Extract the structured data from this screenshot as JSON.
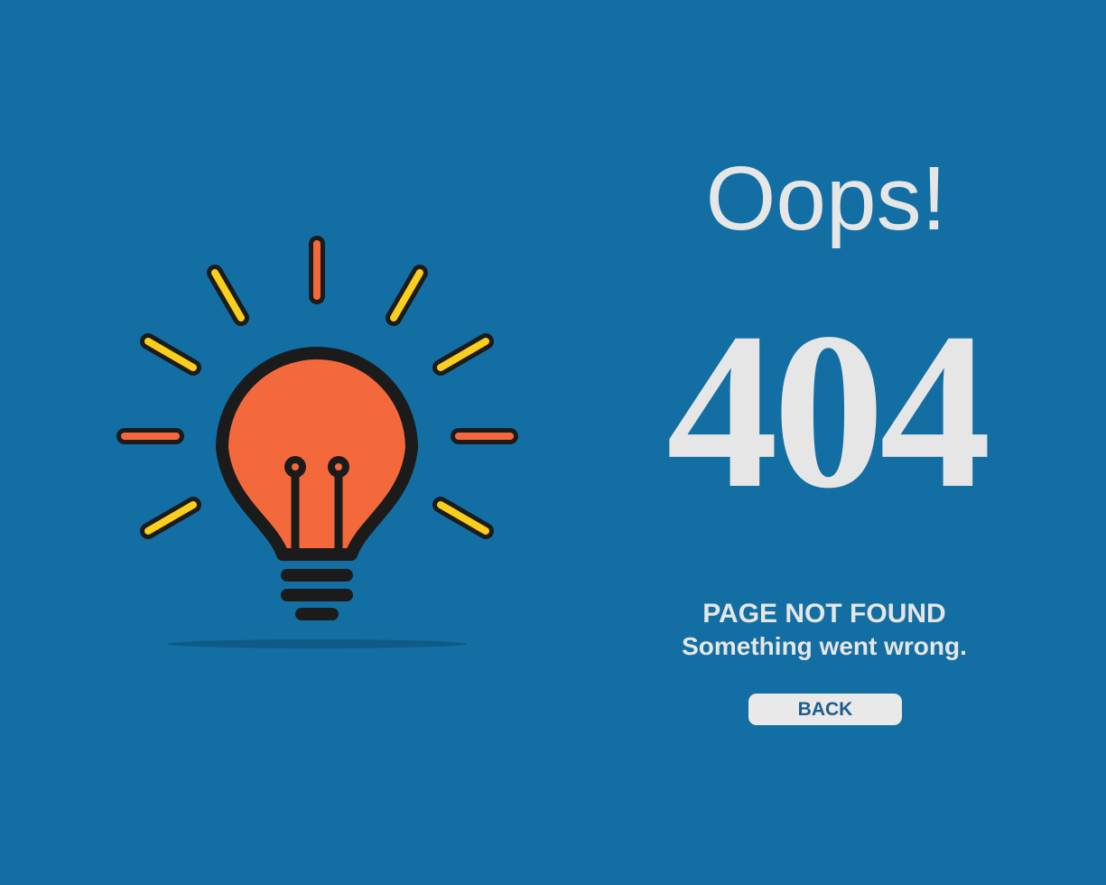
{
  "page": {
    "heading": "Oops!",
    "error_code": "404",
    "title": "PAGE NOT FOUND",
    "subtitle": "Something went wrong.",
    "back_label": "BACK"
  },
  "illustration": {
    "icon": "lightbulb-icon"
  },
  "colors": {
    "background": "#136fa3",
    "text": "#e6e6e6",
    "button_bg": "#e9e9e9",
    "button_text": "#1c5d8e",
    "bulb": "#f4693b",
    "ray_yellow": "#f9cf1c",
    "ray_orange": "#f4693b",
    "outline": "#1b1b1b"
  }
}
